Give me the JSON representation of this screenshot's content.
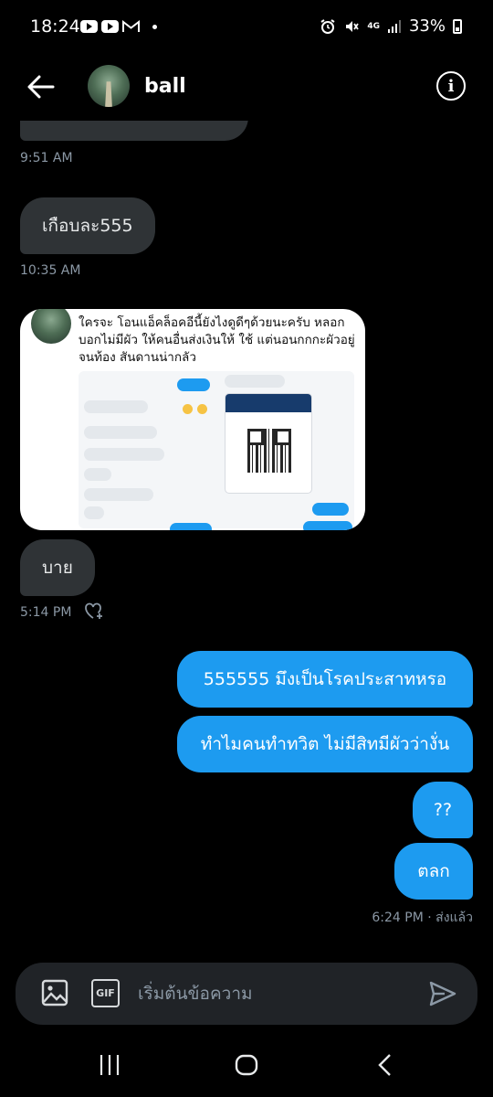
{
  "status_bar": {
    "time": "18:24",
    "battery": "33%",
    "network": "4G"
  },
  "header": {
    "contact_name": "ball"
  },
  "messages": {
    "t1": "9:51 AM",
    "m1": "เกือบละ555",
    "t2": "10:35 AM",
    "image_caption": "ใครจะ โอนแอ็คล็อคอีนี้ยังไงดูดีๆด้วยนะครับ หลอกบอกไม่มีผัว ให้คนอื่นส่งเงินให้ ใช้ แต่นอนกกกะผัวอยู่จนท้อง สันดานน่ากลัว",
    "m2": "บาย",
    "t3": "5:14 PM",
    "o1": "555555 มึงเป็นโรคประสาทหรอ",
    "o2": "ทำไมคนทำทวิต ไม่มีสิทมีผัวว่างั่น",
    "o3": "??",
    "o4": "ตลก",
    "t4": "6:24 PM · ส่งแล้ว"
  },
  "composer": {
    "placeholder": "เริ่มต้นข้อความ",
    "gif_label": "GIF"
  },
  "colors": {
    "background": "#000000",
    "incoming_bubble": "#2f3336",
    "outgoing_bubble": "#1d9bf0",
    "composer": "#202327",
    "meta_text": "#8b98a5"
  }
}
